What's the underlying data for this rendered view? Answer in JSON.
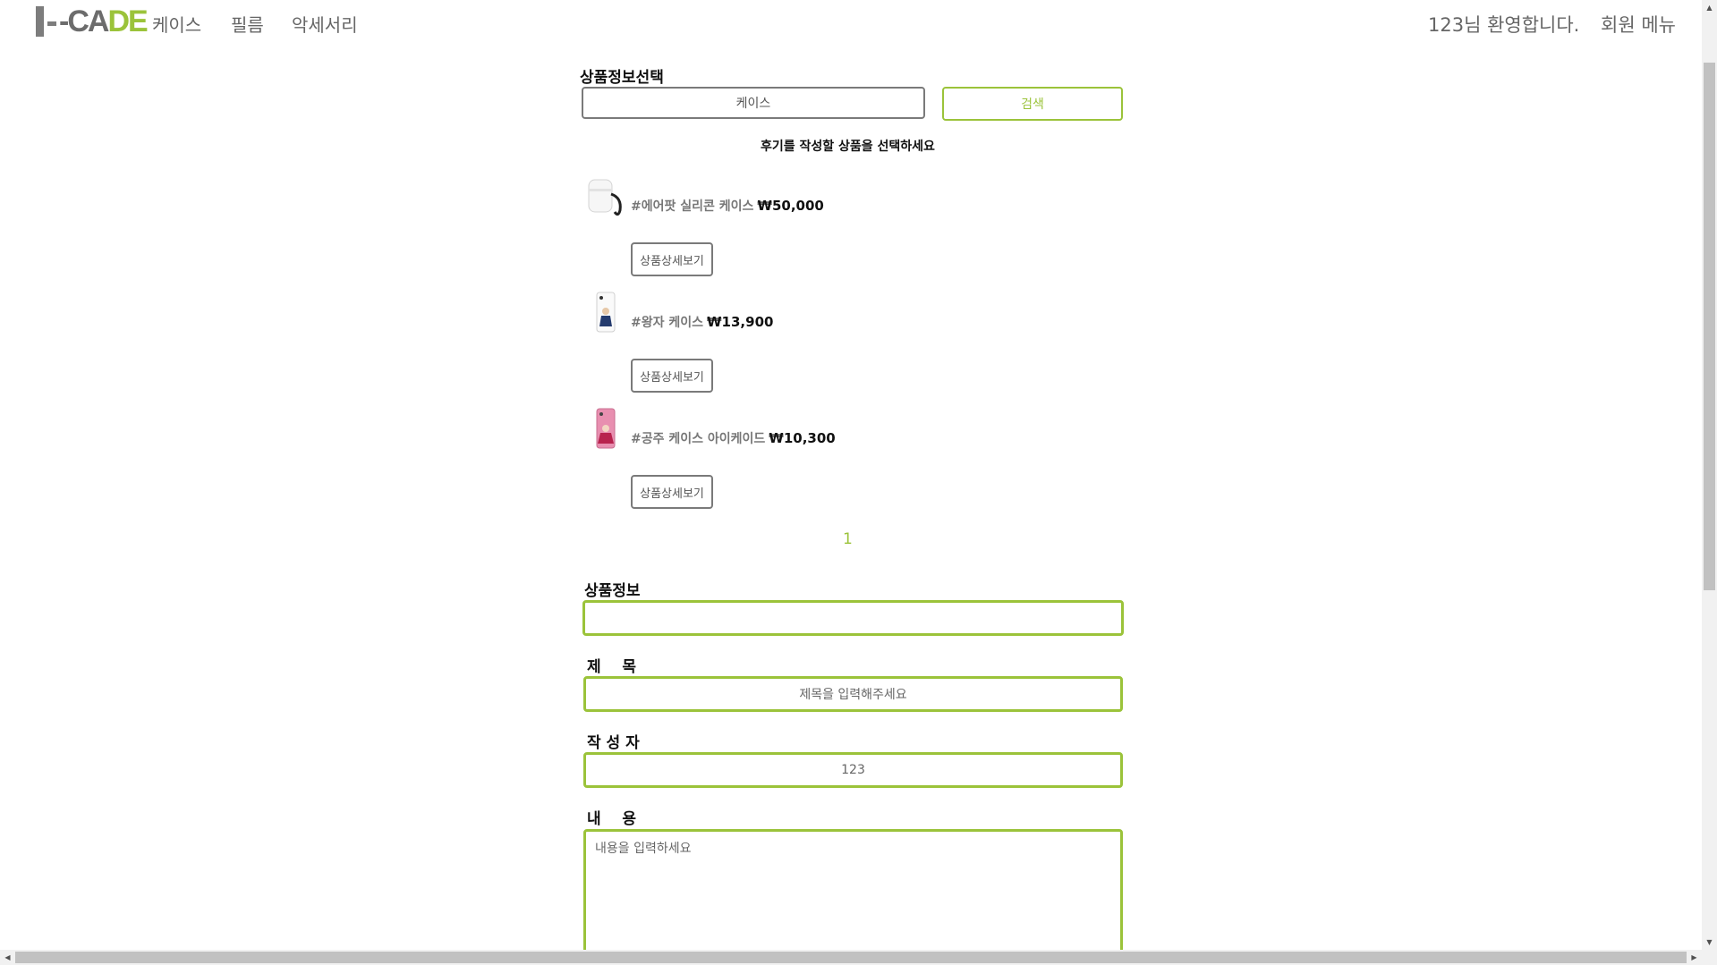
{
  "nav": {
    "logo_text_left": "-CA",
    "logo_text_right": "DE",
    "menu": [
      "케이스",
      "필름",
      "악세서리"
    ],
    "welcome": "123님 환영합니다.",
    "member_menu": "회원 메뉴"
  },
  "product_select": {
    "title": "상품정보선택",
    "category_value": "케이스",
    "search_button": "검색",
    "instruction": "후기를 작성할 상품을 선택하세요",
    "items": [
      {
        "name": "#에어팟 실리콘 케이스",
        "price": "₩50,000",
        "detail_button": "상품상세보기"
      },
      {
        "name": "#왕자 케이스",
        "price": "₩13,900",
        "detail_button": "상품상세보기"
      },
      {
        "name": "#공주 케이스 아이케이드",
        "price": "₩10,300",
        "detail_button": "상품상세보기"
      }
    ],
    "page": "1"
  },
  "form": {
    "product_info_label": "상품정보",
    "product_info_value": "",
    "title_label": "제    목",
    "title_placeholder": "제목을 입력해주세요",
    "author_label": "작 성 자",
    "author_value": "123",
    "content_label": "내    용",
    "content_placeholder": "내용을 입력하세요"
  },
  "colors": {
    "accent": "#9bc33a",
    "logo_gray": "#6c6c6c",
    "border_gray": "#7a7a7a"
  }
}
